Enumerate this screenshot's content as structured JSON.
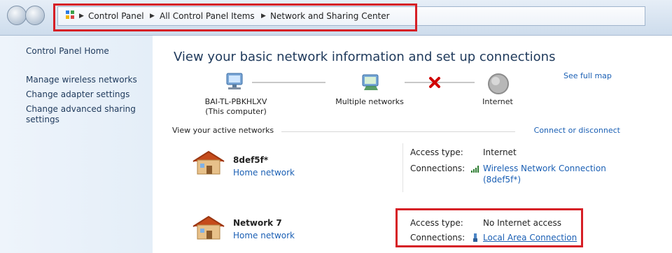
{
  "breadcrumb": [
    "Control Panel",
    "All Control Panel Items",
    "Network and Sharing Center"
  ],
  "sidebar": {
    "home": "Control Panel Home",
    "items": [
      {
        "label": "Manage wireless networks"
      },
      {
        "label": "Change adapter settings"
      },
      {
        "label": "Change advanced sharing settings"
      }
    ]
  },
  "main": {
    "title": "View your basic network information and set up connections",
    "see_full_map": "See full map",
    "nodes": {
      "computer_name": "BAI-TL-PBKHLXV",
      "computer_sub": "(This computer)",
      "multiple_networks": "Multiple networks",
      "internet": "Internet"
    },
    "active_networks_label": "View your active networks",
    "connect_disconnect": "Connect or disconnect",
    "networks": [
      {
        "name": "8def5f*",
        "type": "Home network",
        "access_type_label": "Access type:",
        "access_type": "Internet",
        "connections_label": "Connections:",
        "connection": "Wireless Network Connection",
        "connection_sub": "(8def5f*)"
      },
      {
        "name": "Network 7",
        "type": "Home network",
        "access_type_label": "Access type:",
        "access_type": "No Internet access",
        "connections_label": "Connections:",
        "connection": "Local Area Connection"
      }
    ]
  },
  "colors": {
    "accent": "#1a5fb4",
    "title": "#1e395b",
    "highlight": "#d61f26",
    "disconnected": "#d00000"
  }
}
